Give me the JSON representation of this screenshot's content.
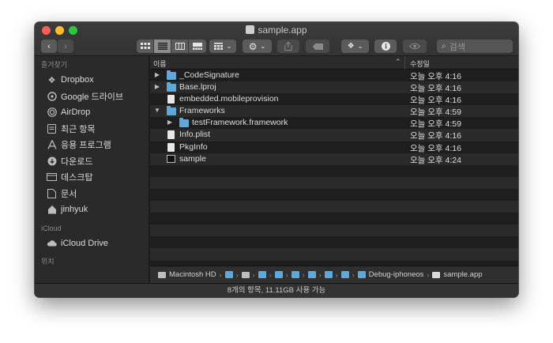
{
  "window": {
    "title": "sample.app"
  },
  "toolbar": {
    "back_icon": "chevron-left",
    "forward_icon": "chevron-right"
  },
  "search": {
    "placeholder": "검색"
  },
  "sidebar": {
    "favorites_header": "즐겨찾기",
    "favorites": [
      {
        "label": "Dropbox",
        "icon": "dropbox-icon"
      },
      {
        "label": "Google 드라이브",
        "icon": "google-drive-icon"
      },
      {
        "label": "AirDrop",
        "icon": "airdrop-icon"
      },
      {
        "label": "최근 항목",
        "icon": "recents-icon"
      },
      {
        "label": "응용 프로그램",
        "icon": "applications-icon"
      },
      {
        "label": "다운로드",
        "icon": "downloads-icon"
      },
      {
        "label": "데스크탑",
        "icon": "desktop-icon"
      },
      {
        "label": "문서",
        "icon": "documents-icon"
      },
      {
        "label": "jinhyuk",
        "icon": "home-icon"
      }
    ],
    "icloud_header": "iCloud",
    "icloud": [
      {
        "label": "iCloud Drive",
        "icon": "icloud-icon"
      }
    ],
    "locations_header": "위치"
  },
  "columns": {
    "name": "이름",
    "date": "수정일"
  },
  "files": [
    {
      "name": "_CodeSignature",
      "date": "오늘 오후 4:16",
      "type": "folder",
      "level": 0,
      "disclosure": "collapsed"
    },
    {
      "name": "Base.lproj",
      "date": "오늘 오후 4:16",
      "type": "folder",
      "level": 0,
      "disclosure": "collapsed"
    },
    {
      "name": "embedded.mobileprovision",
      "date": "오늘 오후 4:16",
      "type": "doc",
      "level": 0,
      "disclosure": "none"
    },
    {
      "name": "Frameworks",
      "date": "오늘 오후 4:59",
      "type": "folder",
      "level": 0,
      "disclosure": "expanded"
    },
    {
      "name": "testFramework.framework",
      "date": "오늘 오후 4:59",
      "type": "folder",
      "level": 1,
      "disclosure": "collapsed"
    },
    {
      "name": "Info.plist",
      "date": "오늘 오후 4:16",
      "type": "doc",
      "level": 0,
      "disclosure": "none"
    },
    {
      "name": "PkgInfo",
      "date": "오늘 오후 4:16",
      "type": "doc",
      "level": 0,
      "disclosure": "none"
    },
    {
      "name": "sample",
      "date": "오늘 오후 4:24",
      "type": "exec",
      "level": 0,
      "disclosure": "none"
    }
  ],
  "pathbar": {
    "root": "Macintosh HD",
    "middle_count": 8,
    "parent": "Debug-iphoneos",
    "current": "sample.app"
  },
  "status": {
    "text": "8개의 항목, 11.11GB 사용 가능"
  },
  "colors": {
    "folder": "#5fa8dc",
    "window_bg": "#1e1e1e",
    "sidebar_bg": "#2a2a2a"
  }
}
